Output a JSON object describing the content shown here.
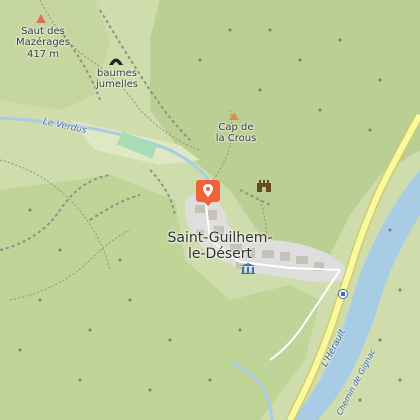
{
  "map": {
    "colors": {
      "land": "#cfdcab",
      "forest": "#b9cf93",
      "scrub": "#c6d6a0",
      "water": "#a9cce6",
      "river_text": "#3f6fae",
      "road_major": "#f7fa9e",
      "road_casing": "#d6c96a",
      "built": "#dedede",
      "building": "#c7c1b8",
      "marker": "#f0623a"
    },
    "labels": {
      "saut_name": "Saut des\nMazérages",
      "saut_elev": "417 m",
      "baumes": "baumes\njumelles",
      "le_verdus": "Le Verdus",
      "cap_crous": "Cap de\nla Crous",
      "town": "Saint-Guilhem-\nle-Désert",
      "herault": "L'Hérault",
      "chemin": "Chemin de Gignac"
    },
    "icons": {
      "peak": "peak-triangle-icon",
      "cave": "cave-icon",
      "viewpoint": "viewpoint-icon",
      "castle": "castle-ruins-icon",
      "museum": "museum-icon",
      "bus_stop": "bus-stop-icon",
      "location_marker": "location-pin-icon"
    }
  }
}
